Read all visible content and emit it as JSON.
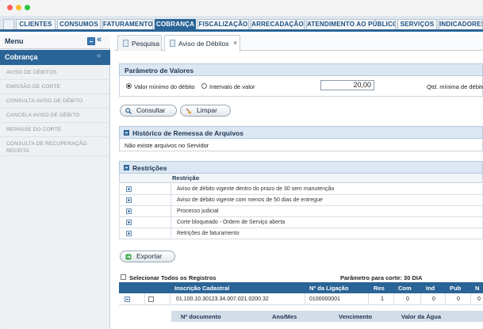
{
  "top_nav": {
    "tabs": [
      {
        "label": "CLIENTES"
      },
      {
        "label": "CONSUMOS"
      },
      {
        "label": "FATURAMENTO"
      },
      {
        "label": "COBRANÇA"
      },
      {
        "label": "FISCALIZAÇÃO"
      },
      {
        "label": "ARRECADAÇÃO"
      },
      {
        "label": "ATENDIMENTO AO PÚBLICO"
      },
      {
        "label": "SERVIÇOS"
      },
      {
        "label": "INDICADORES"
      }
    ],
    "active": "COBRANÇA"
  },
  "sidebar": {
    "title": "Menu",
    "section": "Cobrança",
    "items": [
      {
        "label": "AVISO DE DÉBITOS"
      },
      {
        "label": "EMISSÃO DE CORTE"
      },
      {
        "label": "CONSULTA AVISO DE DÉBITO"
      },
      {
        "label": "CANCELA AVISO DE DÉBITO"
      },
      {
        "label": "REPASSE DO CORTE"
      },
      {
        "label": "CONSULTA DE RECUPERAÇÃO RECEITA"
      }
    ]
  },
  "content_tabs": [
    {
      "label": "Pesquisa"
    },
    {
      "label": "Aviso de Débitos",
      "close": "×"
    }
  ],
  "parametro": {
    "title": "Parâmetro de Valores",
    "option_min": "Valor mínimo do débito",
    "option_interval": "Intervalo de valor",
    "selected": "Valor mínimo do débito",
    "value": "20,00",
    "qtd_label": "Qtd. mínima de débitos"
  },
  "buttons": {
    "consultar": "Consultar",
    "limpar": "Limpar",
    "exportar": "Exportar"
  },
  "historico": {
    "title": "Histórico de Remessa de Arquivos",
    "message": "Não existe arquivos no Servidor"
  },
  "restricoes": {
    "title": "Restrições",
    "column": "Restrição",
    "rows": [
      {
        "text": "Aviso de débito vigente dentro do prazo de 30 sem manutenção"
      },
      {
        "text": "Aviso de débito vigente com menos de 50 dias de entregue"
      },
      {
        "text": "Processo judicial"
      },
      {
        "text": "Corte bloqueado - Ordem de Serviço aberta"
      },
      {
        "text": "Retrições de faturamento"
      }
    ]
  },
  "registros": {
    "select_all": "Selecionar Todos os Registros",
    "param_corte": "Parâmetro para corte: 30 DIA",
    "columns": [
      "Inscrição Cadastral",
      "Nº da Ligação",
      "Res",
      "Com",
      "Ind",
      "Pub",
      "N"
    ],
    "rows": [
      {
        "inscricao": "01.100.10.30123.34.007.021.0200.32",
        "ligacao": "0100000001",
        "res": "1",
        "com": "0",
        "ind": "0",
        "pub": "0",
        "n": "0"
      }
    ],
    "sub_columns": [
      "Nº documento",
      "Ano/Mes",
      "Vencimento",
      "Valor da Água"
    ]
  },
  "icons": {
    "sidebar_collapse": "double-chevron-left-icon",
    "consultar_icon": "search-icon",
    "limpar_icon": "broom-icon",
    "exportar_icon": "export-icon"
  },
  "colors": {
    "primary": "#2a6496",
    "panel_header": "#dbe7f3"
  }
}
